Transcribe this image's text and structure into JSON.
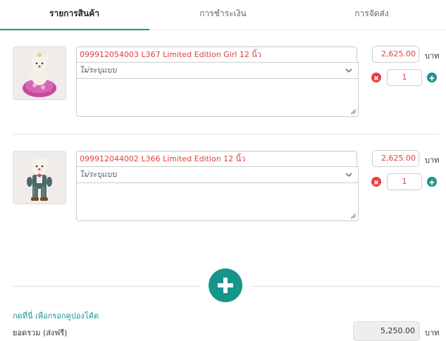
{
  "tabs": [
    {
      "label": "รายการสินค้า",
      "active": true
    },
    {
      "label": "การชำระเงิน",
      "active": false
    },
    {
      "label": "การจัดส่ง",
      "active": false
    }
  ],
  "items": [
    {
      "name": "099912054003 L367 Limited Edition Girl 12 นิ้ว",
      "variant_placeholder": "ไม่ระบุแบบ",
      "price": "2,625.00",
      "unit": "บาท",
      "quantity": "1",
      "image": "teddy-bear-girl-pink-dress"
    },
    {
      "name": "099912044002 L366 Limited Edition 12 นิ้ว",
      "variant_placeholder": "ไม่ระบุแบบ",
      "price": "2,625.00",
      "unit": "บาท",
      "quantity": "1",
      "image": "teddy-bear-boy-suit"
    }
  ],
  "coupon_link": "กดที่นี่ เพื่อกรอกคูปองโค้ด",
  "summary": {
    "total_label": "ยอดรวม (ส่งฟรี)",
    "total_value": "5,250.00",
    "total_unit": "บาท"
  },
  "colors": {
    "accent": "#16968a",
    "danger": "#e84040",
    "price_text": "#e04040"
  },
  "icons": {
    "remove": "circle-x-icon",
    "add": "circle-plus-icon",
    "add_item": "plus-circle-icon",
    "dropdown": "chevron-down-icon"
  }
}
